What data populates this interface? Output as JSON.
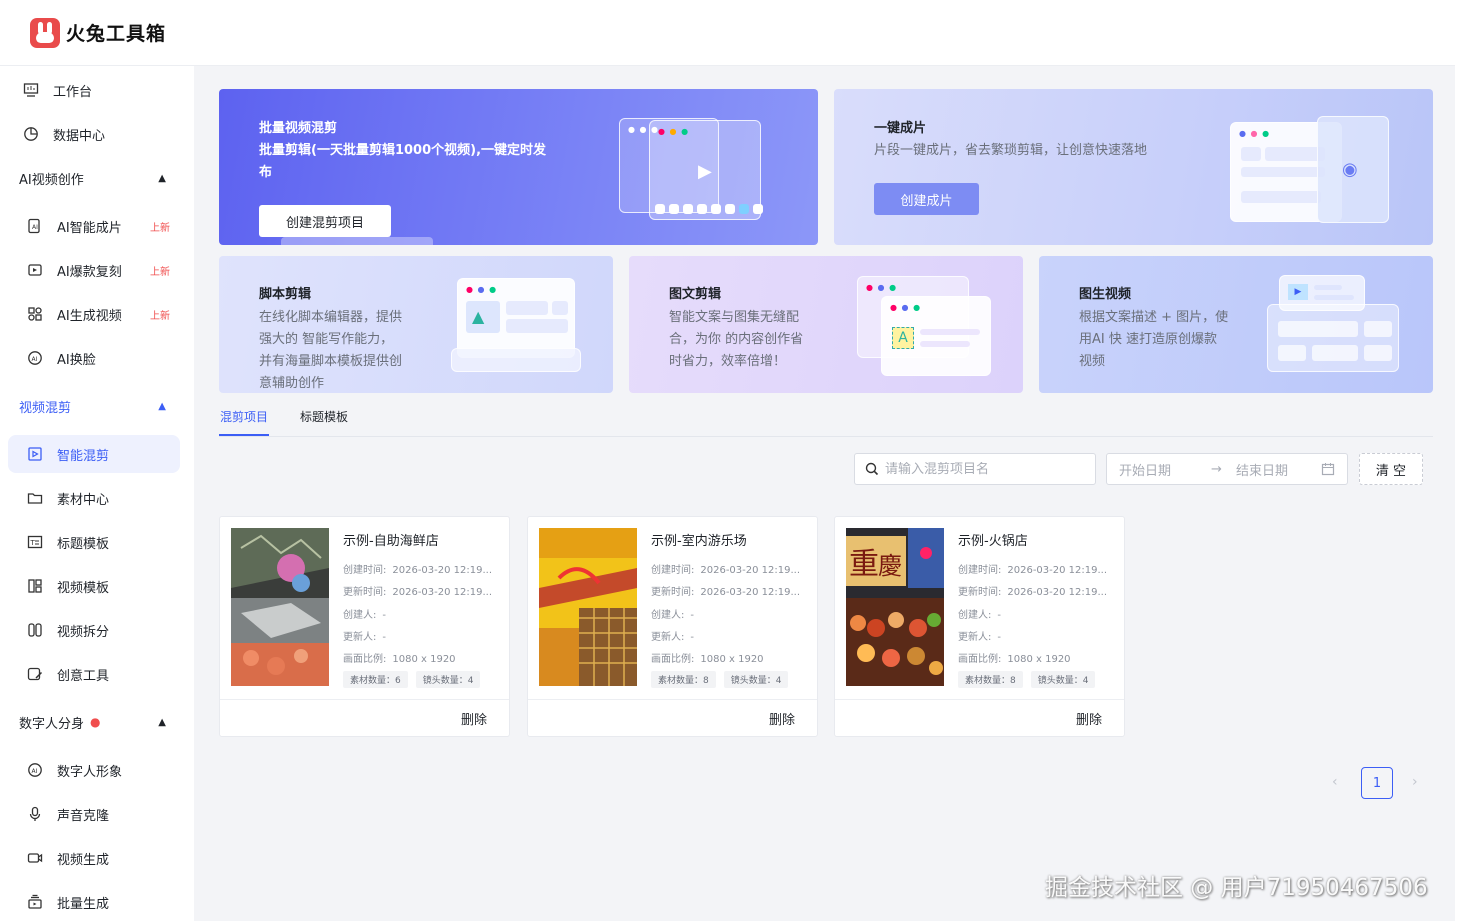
{
  "app": {
    "title": "火兔工具箱"
  },
  "sidebar": {
    "top_items": [
      {
        "label": "工作台",
        "icon": "monitor-icon"
      },
      {
        "label": "数据中心",
        "icon": "pie-chart-icon"
      }
    ],
    "groups": [
      {
        "title": "AI视频创作",
        "items": [
          {
            "label": "AI智能成片",
            "badge": "上新",
            "icon": "ai-film-icon"
          },
          {
            "label": "AI爆款复刻",
            "badge": "上新",
            "icon": "copy-video-icon"
          },
          {
            "label": "AI生成视频",
            "badge": "上新",
            "icon": "generate-icon"
          },
          {
            "label": "AI换脸",
            "badge": "",
            "icon": "face-swap-icon"
          }
        ]
      },
      {
        "title": "视频混剪",
        "items": [
          {
            "label": "智能混剪",
            "icon": "smart-cut-icon"
          },
          {
            "label": "素材中心",
            "icon": "folder-icon"
          },
          {
            "label": "标题模板",
            "icon": "title-template-icon"
          },
          {
            "label": "视频模板",
            "icon": "layout-icon"
          },
          {
            "label": "视频拆分",
            "icon": "split-icon"
          },
          {
            "label": "创意工具",
            "icon": "creative-icon"
          }
        ]
      },
      {
        "title": "数字人分身",
        "items": [
          {
            "label": "数字人形象",
            "icon": "avatar-icon"
          },
          {
            "label": "声音克隆",
            "icon": "microphone-icon"
          },
          {
            "label": "视频生成",
            "icon": "video-camera-icon"
          },
          {
            "label": "批量生成",
            "icon": "batch-icon"
          }
        ]
      }
    ]
  },
  "banners": {
    "main": {
      "title": "批量视频混剪",
      "desc_line1": "批量剪辑(一天批量剪辑1000个视频),一键定时发",
      "desc_line2": "布",
      "button": "创建混剪项目"
    },
    "one_click": {
      "title": "一键成片",
      "desc": "片段一键成片，省去繁琐剪辑，让创意快速落地",
      "button": "创建成片"
    },
    "script": {
      "title": "脚本剪辑",
      "lines": [
        "在线化脚本编辑器，提供",
        "强大的 智能写作能力，",
        "并有海量脚本模板提供创",
        "意辅助创作"
      ]
    },
    "pictext": {
      "title": "图文剪辑",
      "lines": [
        "智能文案与图集无缝配",
        "合，为你 的内容创作省",
        "时省力，效率倍增！"
      ]
    },
    "imgvideo": {
      "title": "图生视频",
      "lines": [
        "根据文案描述 + 图片，使",
        "用AI 快 速打造原创爆款",
        "视频"
      ]
    }
  },
  "tabs": [
    {
      "label": "混剪项目",
      "active": true
    },
    {
      "label": "标题模板",
      "active": false
    }
  ],
  "filters": {
    "search_placeholder": "请输入混剪项目名",
    "start_placeholder": "开始日期",
    "end_placeholder": "结束日期",
    "clear": "清 空"
  },
  "projects": [
    {
      "name": "示例-自助海鲜店",
      "created_label": "创建时间:",
      "created": "2026-03-20 12:19...",
      "updated_label": "更新时间:",
      "updated": "2026-03-20 12:19...",
      "creator_label": "创建人:",
      "creator": "-",
      "updater_label": "更新人:",
      "updater": "-",
      "ratio_label": "画面比例:",
      "ratio": "1080 x 1920",
      "materials": "素材数量：6",
      "shots": "镜头数量：4",
      "delete": "删除"
    },
    {
      "name": "示例-室内游乐场",
      "created_label": "创建时间:",
      "created": "2026-03-20 12:19...",
      "updated_label": "更新时间:",
      "updated": "2026-03-20 12:19...",
      "creator_label": "创建人:",
      "creator": "-",
      "updater_label": "更新人:",
      "updater": "-",
      "ratio_label": "画面比例:",
      "ratio": "1080 x 1920",
      "materials": "素材数量：8",
      "shots": "镜头数量：4",
      "delete": "删除"
    },
    {
      "name": "示例-火锅店",
      "created_label": "创建时间:",
      "created": "2026-03-20 12:19...",
      "updated_label": "更新时间:",
      "updated": "2026-03-20 12:19...",
      "creator_label": "创建人:",
      "creator": "-",
      "updater_label": "更新人:",
      "updater": "-",
      "ratio_label": "画面比例:",
      "ratio": "1080 x 1920",
      "materials": "素材数量：8",
      "shots": "镜头数量：4",
      "delete": "删除"
    }
  ],
  "pagination": {
    "current": "1",
    "prev": "‹",
    "next": "›"
  },
  "watermark": "掘金技术社区 @ 用户71950467506",
  "colors": {
    "accent": "#3c5ef5",
    "badge": "#f04d4d"
  }
}
